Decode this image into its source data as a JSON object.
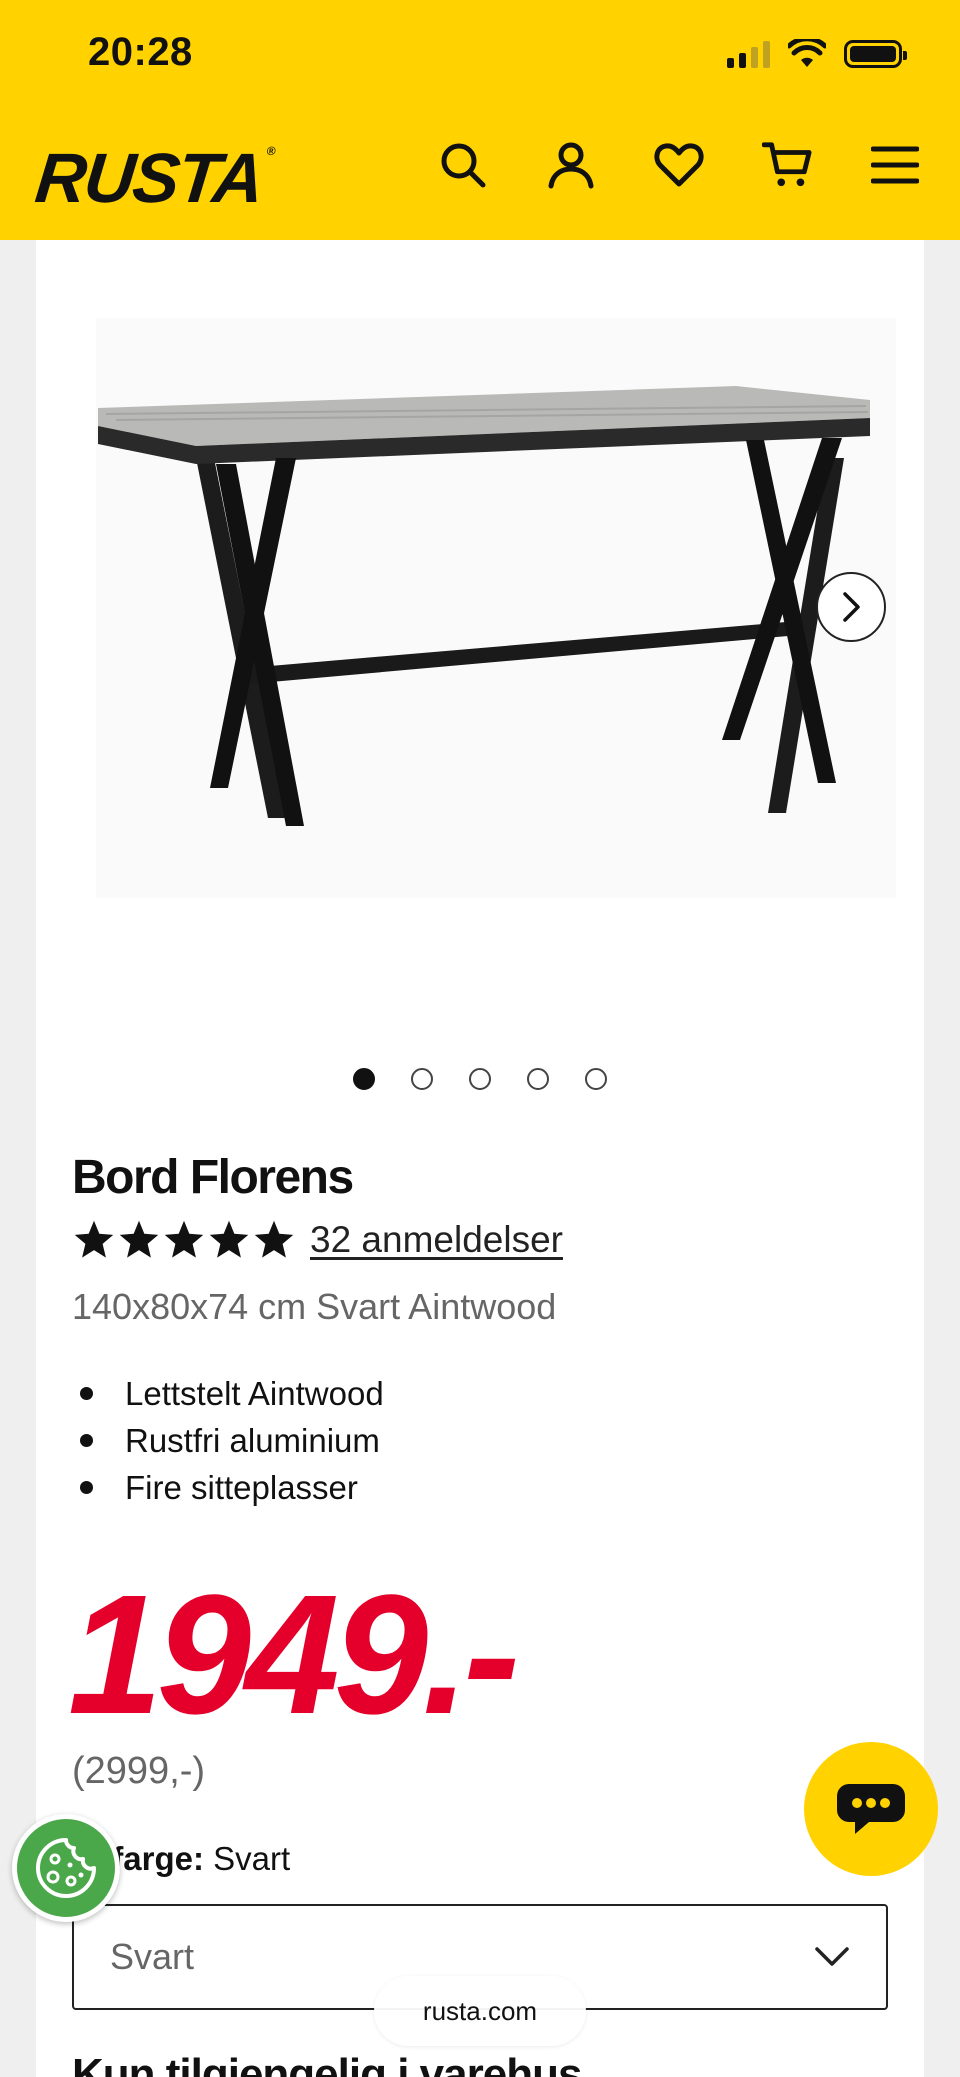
{
  "status_bar": {
    "time": "20:28",
    "icons": [
      "cellular-signal-icon",
      "wifi-icon",
      "battery-icon"
    ]
  },
  "header": {
    "logo": "RUSTA",
    "icons": [
      "search-icon",
      "account-icon",
      "heart-icon",
      "cart-icon",
      "menu-icon"
    ]
  },
  "gallery": {
    "image": "product-table-image",
    "image_count": 5,
    "active_index": 0,
    "next_icon": "chevron-right-icon"
  },
  "product": {
    "title": "Bord Florens",
    "rating_stars": 5,
    "reviews_label": "32 anmeldelser",
    "subtitle": "140x80x74 cm Svart Aintwood",
    "features": [
      "Lettstelt Aintwood",
      "Rustfri aluminium",
      "Fire sitteplasser"
    ],
    "price": "1949.-",
    "old_price": "(2999,-)",
    "price_color": "#e4002b"
  },
  "color_picker": {
    "label_prefix": "gt farge:",
    "label_value": "Svart",
    "selected": "Svart"
  },
  "next_section_heading": "Kun tilgjengelig i varehus",
  "browser": {
    "url": "rusta.com"
  },
  "colors": {
    "brand_yellow": "#ffd200",
    "cookie_green": "#4aa84a"
  }
}
